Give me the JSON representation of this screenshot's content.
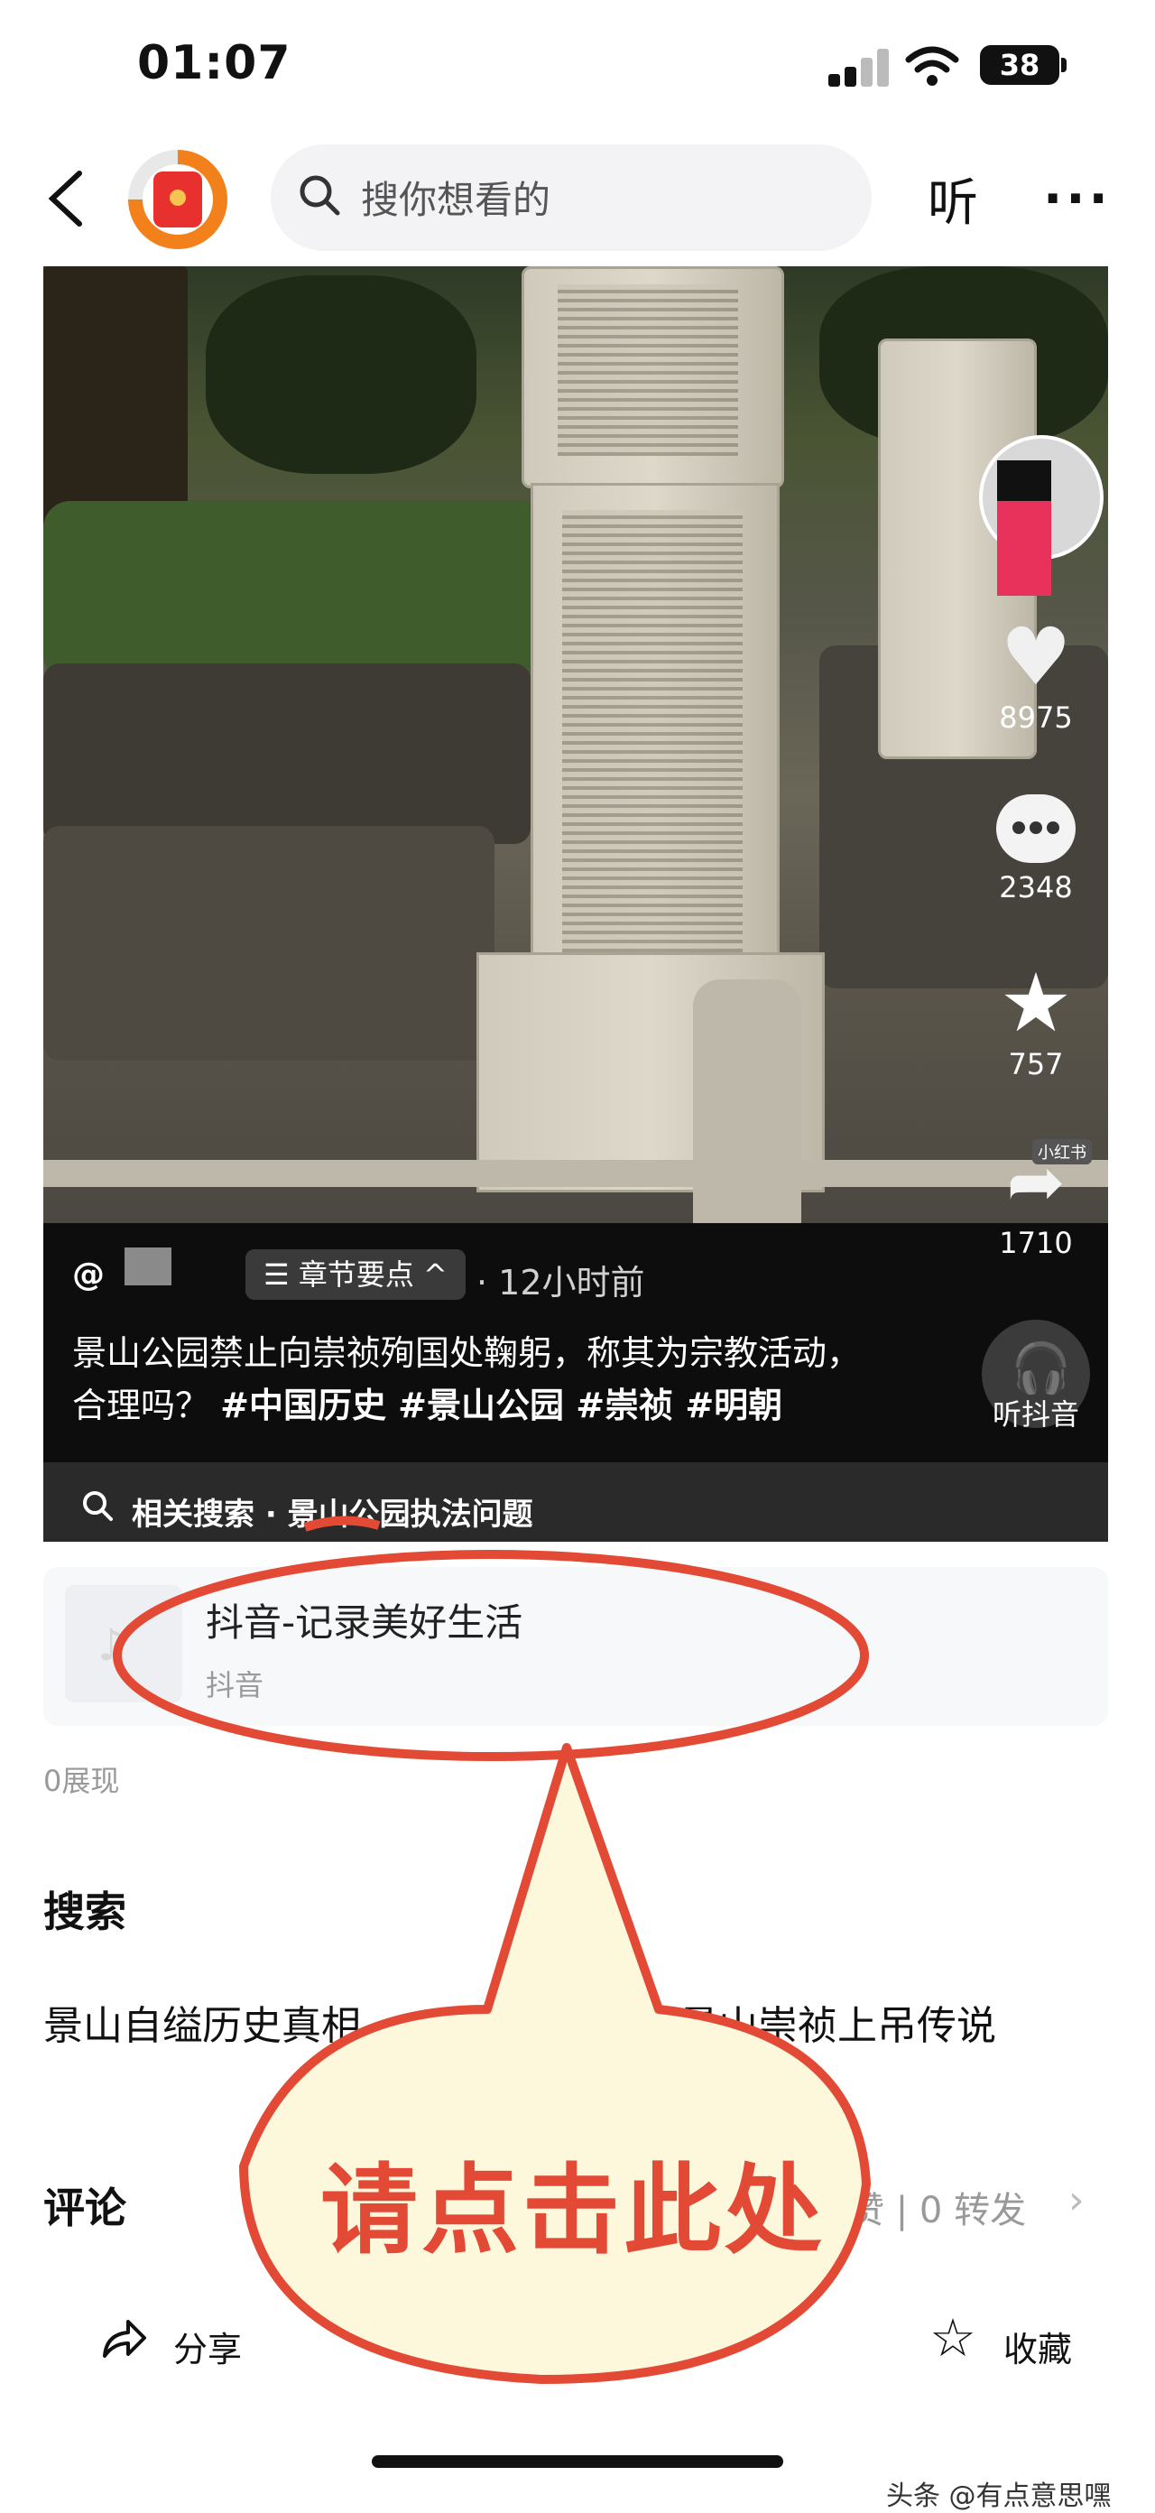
{
  "status_bar": {
    "time": "01:07",
    "battery": "38"
  },
  "nav": {
    "search_placeholder": "搜你想看的",
    "listen_label": "听",
    "more_label": "···"
  },
  "video": {
    "author": "@",
    "chapter_pill": "☰ 章节要点 ^",
    "time_ago": "· 12小时前",
    "caption_text": "景山公园禁止向崇祯殉国处鞠躬，称其为宗教活动，合理吗？",
    "caption_tags": "#中国历史 #景山公园 #崇祯 #明朝",
    "side": {
      "likes": "8975",
      "comments": "2348",
      "favorites": "757",
      "shares": "1710",
      "xhs_badge": "小红书"
    },
    "listen_label": "听抖音",
    "related_search": "相关搜索 · 景山公园执法问题"
  },
  "link_card": {
    "title": "抖音-记录美好生活",
    "source": "抖音",
    "logo": "♪"
  },
  "impressions": "0展现",
  "search": {
    "heading": "搜索",
    "suggestions": [
      "景山自缢历史真相",
      "京景山崇祯上吊传说"
    ]
  },
  "comments": {
    "heading": "评论",
    "stats": "赞 | 0 转发",
    "arrow": "›"
  },
  "bottom_bar": {
    "share_label": "分享",
    "collect_label": "收藏"
  },
  "annotation": {
    "label": "请点击此处",
    "color": "#e24a36",
    "fill": "#fdf7dc"
  },
  "watermark": "头条 @有点意思嘿"
}
